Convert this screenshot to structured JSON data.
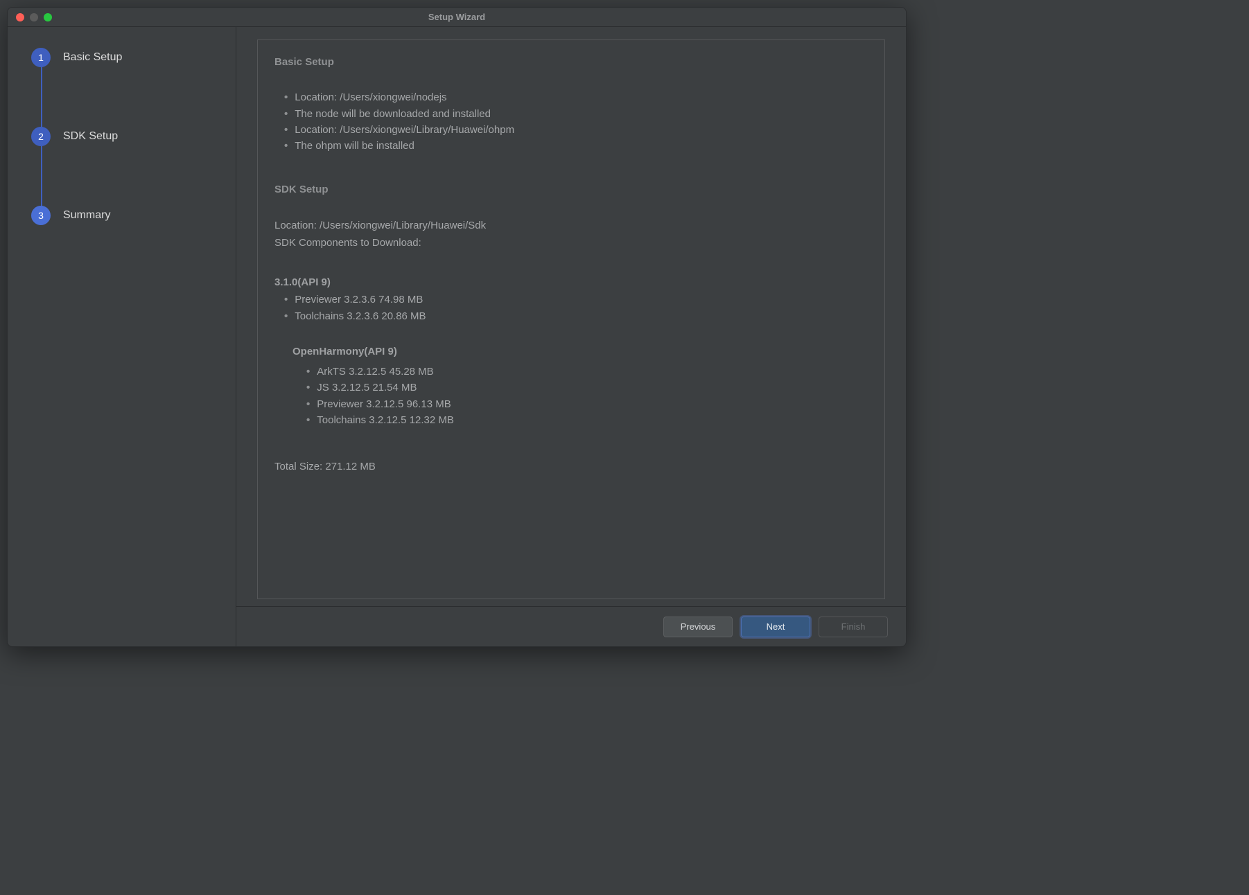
{
  "window": {
    "title": "Setup Wizard"
  },
  "sidebar": {
    "steps": [
      {
        "num": "1",
        "label": "Basic Setup"
      },
      {
        "num": "2",
        "label": "SDK Setup"
      },
      {
        "num": "3",
        "label": "Summary"
      }
    ]
  },
  "content": {
    "basic": {
      "heading": "Basic Setup",
      "lines": [
        "Location: /Users/xiongwei/nodejs",
        "The node will be downloaded and installed",
        "Location: /Users/xiongwei/Library/Huawei/ohpm",
        "The ohpm will be installed"
      ]
    },
    "sdk": {
      "heading": "SDK Setup",
      "location": "Location: /Users/xiongwei/Library/Huawei/Sdk",
      "componentsLabel": "SDK Components to Download:",
      "api1": {
        "heading": "3.1.0(API 9)",
        "items": [
          "Previewer  3.2.3.6  74.98 MB",
          "Toolchains  3.2.3.6  20.86 MB"
        ]
      },
      "api2": {
        "heading": "OpenHarmony(API 9)",
        "items": [
          "ArkTS  3.2.12.5  45.28 MB",
          "JS  3.2.12.5  21.54 MB",
          "Previewer  3.2.12.5  96.13 MB",
          "Toolchains  3.2.12.5  12.32 MB"
        ]
      },
      "total": "Total Size: 271.12 MB"
    }
  },
  "footer": {
    "previous": "Previous",
    "next": "Next",
    "finish": "Finish"
  }
}
